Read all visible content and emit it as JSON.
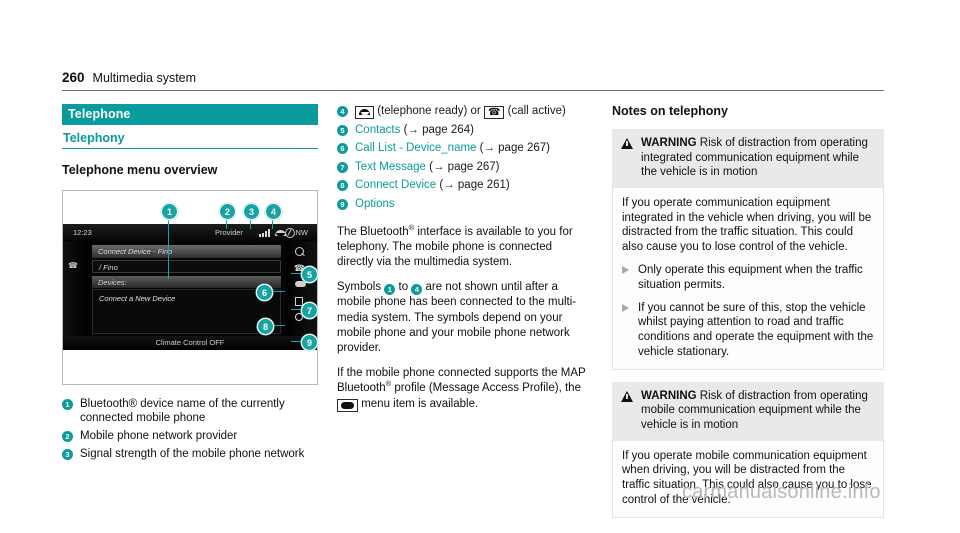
{
  "header": {
    "page_number": "260",
    "section_title": "Multimedia system"
  },
  "left": {
    "section_bar": "Telephone",
    "section_sub": "Telephony",
    "heading": "Telephone menu overview",
    "figure": {
      "clock": "12:23",
      "provider": "Provider",
      "network_mode": "NW",
      "title_bar": "Connect Device - Fino",
      "input_bar": "/ Fino",
      "devices_bar": "Devices:",
      "list_item": "Connect a New Device",
      "status_bar": "Climate Control OFF",
      "callouts": [
        "1",
        "2",
        "3",
        "4",
        "5",
        "6",
        "7",
        "8",
        "9"
      ]
    },
    "legend": [
      {
        "num": "1",
        "text": "Bluetooth® device name of the currently connected mobile phone"
      },
      {
        "num": "2",
        "text": "Mobile phone network provider"
      },
      {
        "num": "3",
        "text": "Signal strength of the mobile phone network"
      }
    ]
  },
  "middle": {
    "items": [
      {
        "num": "4",
        "icon": "handset-icon",
        "label_a": "(telephone ready) or",
        "icon2": "call-active-icon",
        "label_b": "(call active)"
      },
      {
        "num": "5",
        "link": "Contacts",
        "ref": "(→ page 264)"
      },
      {
        "num": "6",
        "link": "Call List - Device_name",
        "ref": "(→ page 267)"
      },
      {
        "num": "7",
        "link": "Text Message",
        "ref": "(→ page 267)"
      },
      {
        "num": "8",
        "link": "Connect Device",
        "ref": "(→ page 261)"
      },
      {
        "num": "9",
        "link": "Options",
        "ref": ""
      }
    ],
    "para1_a": "The Bluetooth",
    "para1_sup": "®",
    "para1_b": " interface is available to you for telephony. The mobile phone is connected directly via the multimedia system.",
    "para2_a": "Symbols",
    "para2_n1": "1",
    "para2_mid": "to",
    "para2_n2": "4",
    "para2_b": "are not shown until after a mobile phone has been connected to the multi-media system. The symbols depend on your mobile phone and your mobile phone network provider.",
    "para3_a": "If the mobile phone connected supports the MAP Bluetooth",
    "para3_sup": "®",
    "para3_b": " profile (Message Access Profile), the",
    "para3_c": "menu item is available."
  },
  "right": {
    "heading": "Notes on telephony",
    "warnings": [
      {
        "label": "WARNING",
        "title": "Risk of distraction from operating integrated communication equipment while the vehicle is in motion",
        "body": "If you operate communication equipment integrated in the vehicle when driving, you will be distracted from the traffic situation. This could also cause you to lose control of the vehicle.",
        "bullets": [
          "Only operate this equipment when the traffic situation permits.",
          "If you cannot be sure of this, stop the vehicle whilst paying attention to road and traffic conditions and operate the equipment with the vehicle stationary."
        ]
      },
      {
        "label": "WARNING",
        "title": "Risk of distraction from operating mobile communication equipment while the vehicle is in motion",
        "body": "If you operate mobile communication equipment when driving, you will be distracted from the traffic situation. This could also cause you to lose control of the vehicle.",
        "bullets": []
      }
    ]
  },
  "watermark": "carmanualsonline.info",
  "colors": {
    "accent_teal": "#0a9c9c",
    "warn_head_bg": "#e9e9e9",
    "watermark_gray": "#b9b9b9"
  }
}
